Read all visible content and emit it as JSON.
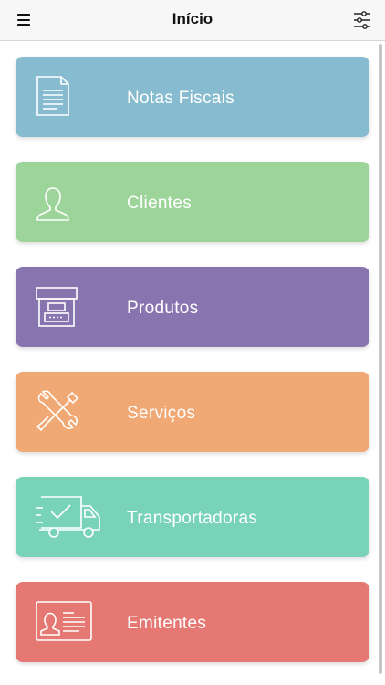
{
  "header": {
    "title": "Início",
    "menu_icon": "hamburger-menu-icon",
    "filter_icon": "sliders-icon"
  },
  "menu": [
    {
      "label": "Notas Fiscais",
      "icon": "document-icon",
      "color": "#87bbcf"
    },
    {
      "label": "Clientes",
      "icon": "person-icon",
      "color": "#9dd49a"
    },
    {
      "label": "Produtos",
      "icon": "archive-box-icon",
      "color": "#8875b0"
    },
    {
      "label": "Serviços",
      "icon": "wrench-screwdriver-icon",
      "color": "#f0a874"
    },
    {
      "label": "Transportadoras",
      "icon": "delivery-truck-icon",
      "color": "#79d3b8"
    },
    {
      "label": "Emitentes",
      "icon": "id-card-icon",
      "color": "#e57873"
    }
  ]
}
